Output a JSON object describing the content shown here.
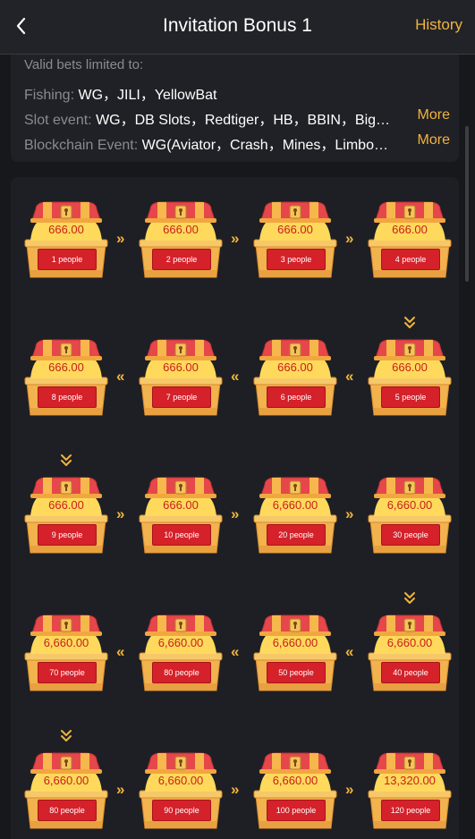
{
  "header": {
    "title": "Invitation Bonus 1",
    "history": "History",
    "back_icon": "chevron-left-icon"
  },
  "valid_bets": {
    "heading": "Valid bets limited to:",
    "rows": [
      {
        "label": "Fishing:",
        "value": "WG，JILI，YellowBat",
        "more": ""
      },
      {
        "label": "Slot event:",
        "value": "WG，DB Slots，Redtiger，HB，BBIN，Big…",
        "more": "More"
      },
      {
        "label": "Blockchain Event:",
        "value": "WG(Aviator，Crash，Mines，Limbo…",
        "more": "More"
      }
    ]
  },
  "rewards": [
    {
      "amount": "666.00",
      "people": "1 people"
    },
    {
      "amount": "666.00",
      "people": "2 people"
    },
    {
      "amount": "666.00",
      "people": "3 people"
    },
    {
      "amount": "666.00",
      "people": "4 people"
    },
    {
      "amount": "666.00",
      "people": "5 people"
    },
    {
      "amount": "666.00",
      "people": "6 people"
    },
    {
      "amount": "666.00",
      "people": "7 people"
    },
    {
      "amount": "666.00",
      "people": "8 people"
    },
    {
      "amount": "666.00",
      "people": "9 people"
    },
    {
      "amount": "666.00",
      "people": "10 people"
    },
    {
      "amount": "6,660.00",
      "people": "20 people"
    },
    {
      "amount": "6,660.00",
      "people": "30 people"
    },
    {
      "amount": "6,660.00",
      "people": "40 people"
    },
    {
      "amount": "6,660.00",
      "people": "50 people"
    },
    {
      "amount": "6,660.00",
      "people": "80 people"
    },
    {
      "amount": "6,660.00",
      "people": "70 people"
    },
    {
      "amount": "6,660.00",
      "people": "80 people"
    },
    {
      "amount": "6,660.00",
      "people": "90 people"
    },
    {
      "amount": "6,660.00",
      "people": "100 people"
    },
    {
      "amount": "13,320.00",
      "people": "120 people"
    }
  ],
  "colors": {
    "accent": "#f0b43c",
    "amount": "#c8201c",
    "badge": "#d4212a",
    "chest_body": "#f2b24e",
    "chest_lid": "#e6474a"
  }
}
